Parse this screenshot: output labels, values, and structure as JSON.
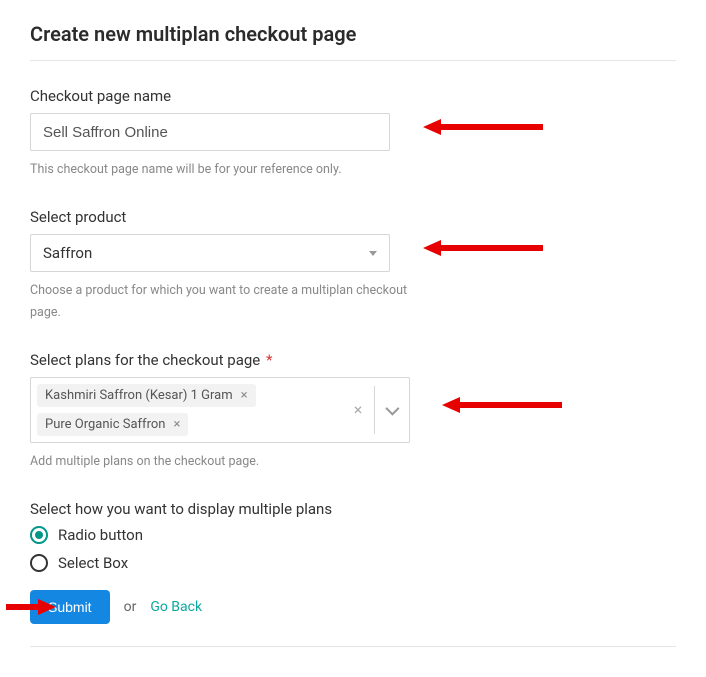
{
  "page": {
    "title": "Create new multiplan checkout page"
  },
  "checkout_name": {
    "label": "Checkout page name",
    "value": "Sell Saffron Online",
    "helper": "This checkout page name will be for your reference only."
  },
  "product": {
    "label": "Select product",
    "value": "Saffron",
    "helper": "Choose a product for which you want to create a multiplan checkout page."
  },
  "plans": {
    "label": "Select plans for the checkout page",
    "required_marker": "*",
    "tags": [
      "Kashmiri Saffron (Kesar) 1 Gram",
      "Pure Organic Saffron"
    ],
    "helper": "Add multiple plans on the checkout page."
  },
  "display": {
    "label": "Select how you want to display multiple plans",
    "options": [
      {
        "label": "Radio button",
        "selected": true
      },
      {
        "label": "Select Box",
        "selected": false
      }
    ]
  },
  "actions": {
    "submit": "Submit",
    "or": "or",
    "go_back": "Go Back"
  }
}
